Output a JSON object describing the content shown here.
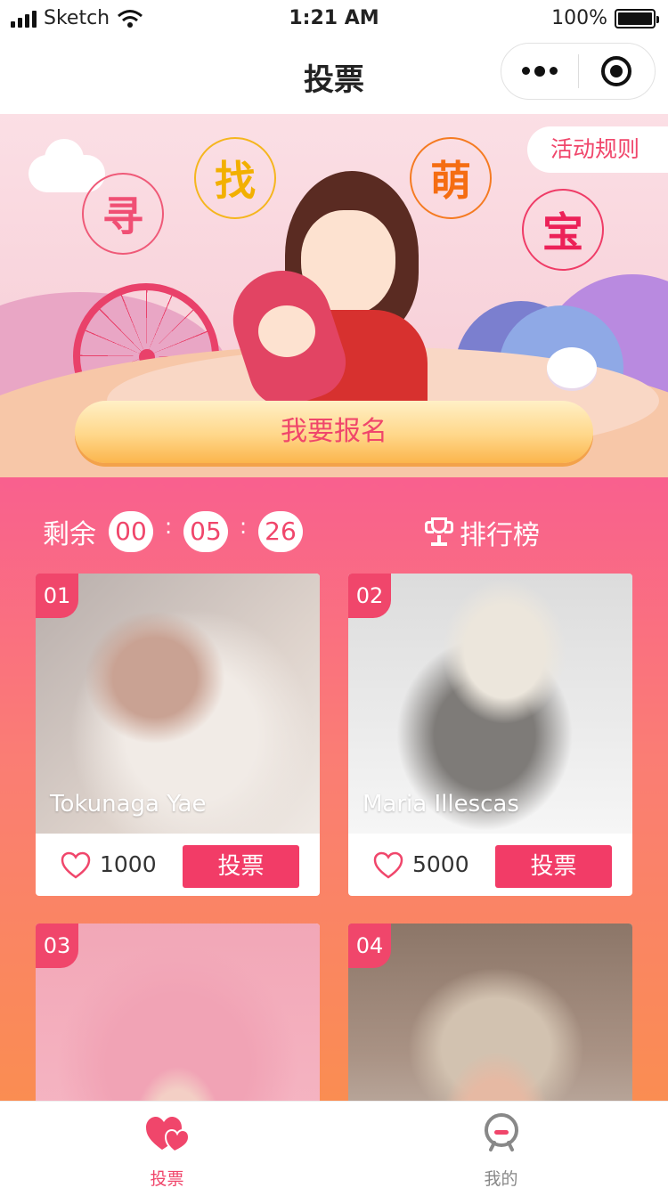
{
  "status_bar": {
    "carrier": "Sketch",
    "time": "1:21 AM",
    "battery": "100%"
  },
  "nav": {
    "title": "投票"
  },
  "banner": {
    "rule_label": "活动规则",
    "title_chars": [
      "寻",
      "找",
      "萌",
      "宝"
    ],
    "signup_label": "我要报名"
  },
  "timer": {
    "label": "剩余",
    "hours": "00",
    "minutes": "05",
    "seconds": "26",
    "separator": ":"
  },
  "ranking": {
    "label": "排行榜"
  },
  "entries": [
    {
      "number": "01",
      "name": "Tokunaga Yae",
      "likes": "1000",
      "vote_label": "投票"
    },
    {
      "number": "02",
      "name": "Maria Illescas",
      "likes": "5000",
      "vote_label": "投票"
    },
    {
      "number": "03"
    },
    {
      "number": "04"
    }
  ],
  "tabbar": {
    "items": [
      {
        "label": "投票",
        "icon": "hearts-icon",
        "active": true
      },
      {
        "label": "我的",
        "icon": "user-icon",
        "active": false
      }
    ]
  },
  "colors": {
    "accent": "#f0466b",
    "vote_button": "#f23c67",
    "gradient_top": "#f9608e",
    "gradient_bottom": "#fa8d52"
  }
}
